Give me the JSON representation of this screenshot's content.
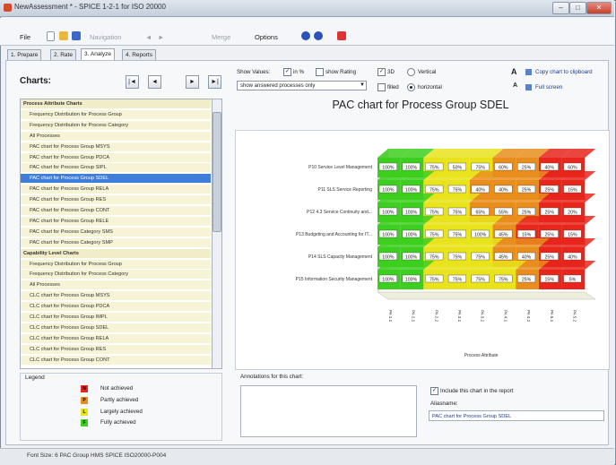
{
  "window": {
    "title": "NewAssessment * - SPICE 1-2-1 for ISO 20000",
    "minimize": "–",
    "maximize": "□",
    "close": "✕"
  },
  "menu": {
    "file": "File",
    "navigation": "Navigation",
    "back": "◄",
    "forward": "►",
    "merge": "Merge",
    "options": "Options"
  },
  "tabs": [
    {
      "label": "1. Prepare"
    },
    {
      "label": "2. Rate"
    },
    {
      "label": "3. Analyze"
    },
    {
      "label": "4. Reports"
    }
  ],
  "charts_panel": {
    "label": "Charts:",
    "nav_first": "|◄",
    "nav_prev": "◄",
    "nav_next": "►",
    "nav_last": "►|"
  },
  "chart_list": [
    {
      "label": "Process Attribute Charts",
      "header": true
    },
    {
      "label": "Frequency Distribution for Process Group"
    },
    {
      "label": "Frequency Distribution for Process Category"
    },
    {
      "label": "All Processes"
    },
    {
      "label": "PAC chart for Process Group MSYS"
    },
    {
      "label": "PAC chart for Process Group PDCA"
    },
    {
      "label": "PAC chart for Process Group SIPL"
    },
    {
      "label": "PAC chart for Process Group SDEL",
      "selected": true
    },
    {
      "label": "PAC chart for Process Group RELA"
    },
    {
      "label": "PAC chart for Process Group RES"
    },
    {
      "label": "PAC chart for Process Group CONT"
    },
    {
      "label": "PAC chart for Process Group RELE"
    },
    {
      "label": "PAC chart for Process Category SMS"
    },
    {
      "label": "PAC chart for Process Category SMP"
    },
    {
      "label": "Capability Level Charts",
      "header": true
    },
    {
      "label": "Frequency Distribution for Process Group"
    },
    {
      "label": "Frequency Distribution for Process Category"
    },
    {
      "label": "All Processes"
    },
    {
      "label": "CLC chart for Process Group MSYS"
    },
    {
      "label": "CLC chart for Process Group PDCA"
    },
    {
      "label": "CLC chart for Process Group IMPL"
    },
    {
      "label": "CLC chart for Process Group SDEL"
    },
    {
      "label": "CLC chart for Process Group RELA"
    },
    {
      "label": "CLC chart for Process Group RES"
    },
    {
      "label": "CLC chart for Process Group CONT"
    }
  ],
  "legend": {
    "title": "Legend",
    "items": [
      {
        "code": "N",
        "label": "Not achieved",
        "color": "#e8261c"
      },
      {
        "code": "P",
        "label": "Partly achieved",
        "color": "#e98e1c"
      },
      {
        "code": "L",
        "label": "Largely achieved",
        "color": "#e8e31b"
      },
      {
        "code": "F",
        "label": "Fully achieved",
        "color": "#3ccf1f"
      }
    ]
  },
  "options": {
    "show_values_label": "Show Values:",
    "in_percent": "in %",
    "show_rating": "show Rating",
    "three_d": "3D",
    "vertical": "Vertical",
    "filled": "filled",
    "horizontal": "horizontal",
    "filter_value": "show answered processes only",
    "copy_chart": "Copy chart to clipboard",
    "full_screen": "Full screen"
  },
  "chart_data": {
    "type": "heatmap",
    "title": "PAC chart for Process Group SDEL",
    "rows": [
      {
        "label": "P10 Service Level Management",
        "values": [
          "100%",
          "100%",
          "75%",
          "50%",
          "75%",
          "60%",
          "25%",
          "40%",
          "60%"
        ],
        "ratings": [
          "F",
          "F",
          "L",
          "L",
          "L",
          "P",
          "P",
          "N",
          "N"
        ]
      },
      {
        "label": "P11 SLS Service Reporting",
        "values": [
          "100%",
          "100%",
          "75%",
          "75%",
          "40%",
          "40%",
          "25%",
          "25%",
          "15%"
        ],
        "ratings": [
          "F",
          "F",
          "L",
          "L",
          "P",
          "P",
          "P",
          "N",
          "N"
        ]
      },
      {
        "label": "P12 4.3 Service Continuity and...",
        "values": [
          "100%",
          "100%",
          "75%",
          "75%",
          "65%",
          "55%",
          "25%",
          "25%",
          "20%"
        ],
        "ratings": [
          "F",
          "F",
          "L",
          "L",
          "P",
          "P",
          "P",
          "N",
          "N"
        ]
      },
      {
        "label": "P13 Budgeting and Accounting for IT...",
        "values": [
          "100%",
          "100%",
          "75%",
          "75%",
          "100%",
          "45%",
          "15%",
          "25%",
          "15%"
        ],
        "ratings": [
          "F",
          "F",
          "L",
          "L",
          "L",
          "P",
          "N",
          "N",
          "N"
        ]
      },
      {
        "label": "P14 SLS Capacity Management",
        "values": [
          "100%",
          "100%",
          "75%",
          "75%",
          "75%",
          "45%",
          "40%",
          "25%",
          "40%"
        ],
        "ratings": [
          "F",
          "F",
          "L",
          "L",
          "L",
          "P",
          "P",
          "N",
          "N"
        ]
      },
      {
        "label": "P15 Information Security Management",
        "values": [
          "100%",
          "100%",
          "75%",
          "75%",
          "75%",
          "75%",
          "25%",
          "15%",
          "5%"
        ],
        "ratings": [
          "F",
          "F",
          "L",
          "L",
          "L",
          "L",
          "P",
          "N",
          "N"
        ]
      }
    ],
    "columns": [
      "PA 1.1",
      "PA 2.1",
      "PA 2.2",
      "PA 3.1",
      "PA 3.2",
      "PA 4.1",
      "PA 4.2",
      "PA 5.1",
      "PA 5.2"
    ],
    "xlabel": "Process Attribute"
  },
  "annotations": {
    "label": "Annotations for this chart:",
    "value": ""
  },
  "include_in_report": "Include this chart in the report",
  "alias": {
    "label": "Aliasname:",
    "value": "PAC chart for Process Group SDEL"
  },
  "status": {
    "text": "Font Size: 6    PAC Group HMS SPICE ISO20000-P004"
  }
}
